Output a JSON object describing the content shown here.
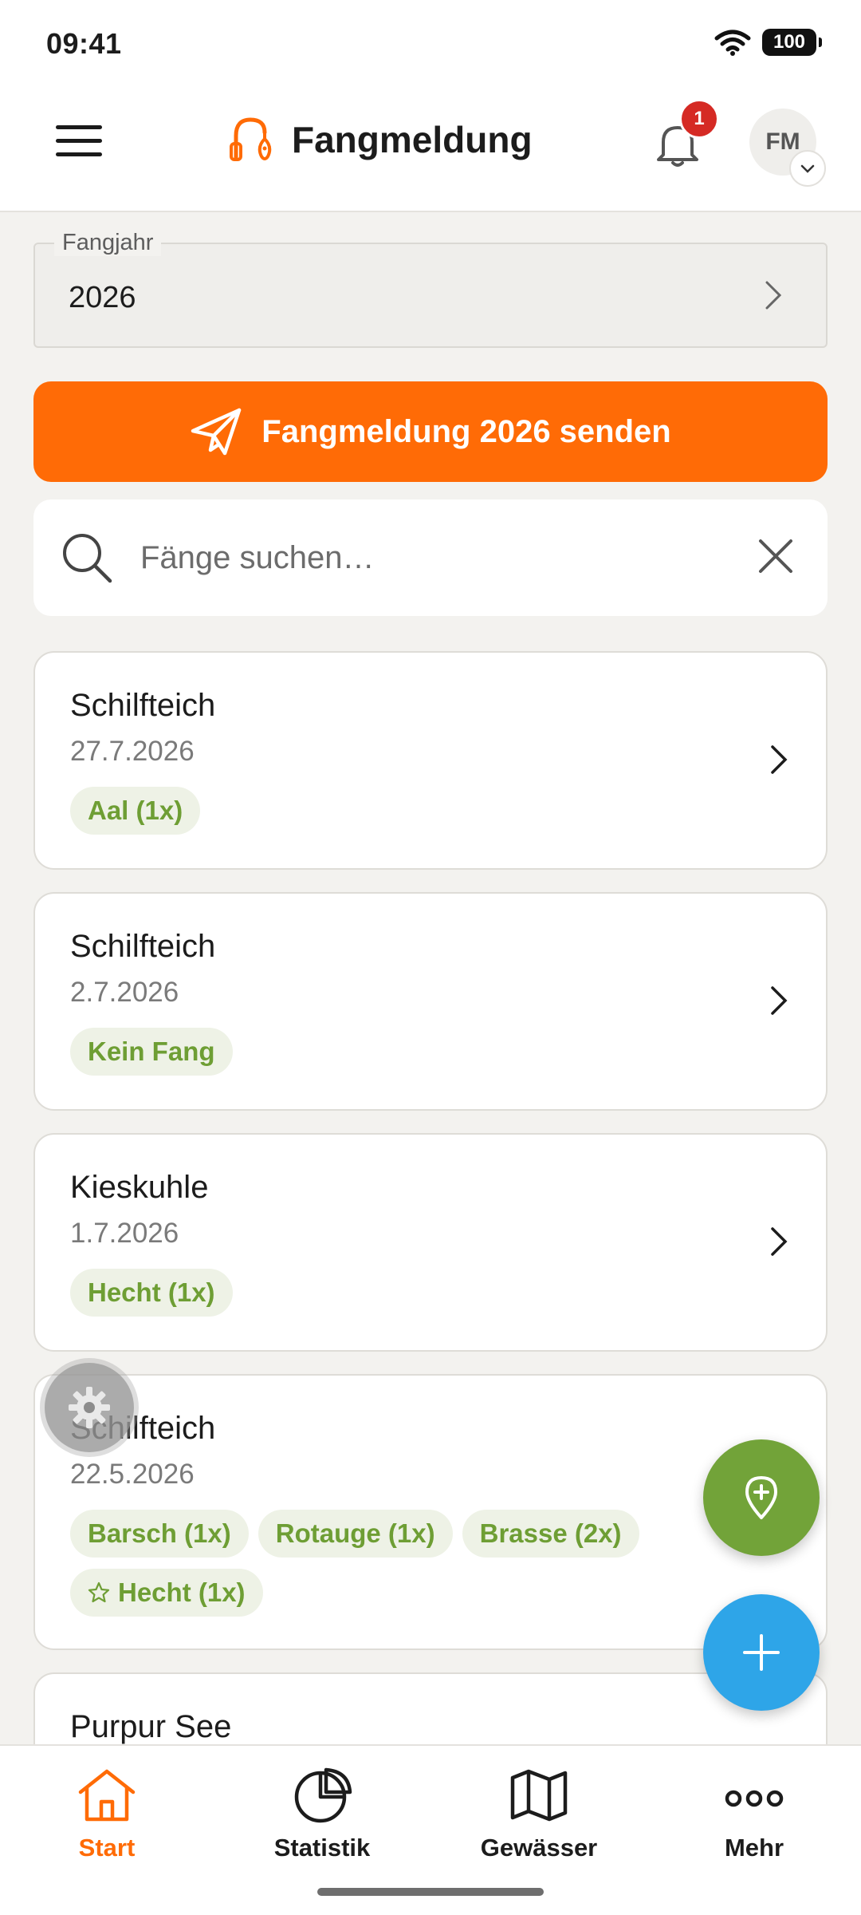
{
  "status_bar": {
    "time": "09:41",
    "battery": "100"
  },
  "header": {
    "title": "Fangmeldung",
    "notification_count": "1",
    "avatar_initials": "FM"
  },
  "year_field": {
    "label": "Fangjahr",
    "value": "2026"
  },
  "send_button": {
    "label": "Fangmeldung 2026 senden"
  },
  "search": {
    "placeholder": "Fänge suchen…",
    "value": ""
  },
  "catches": [
    {
      "water": "Schilfteich",
      "date": "27.7.2026",
      "tags": [
        "Aal (1x)"
      ]
    },
    {
      "water": "Schilfteich",
      "date": "2.7.2026",
      "tags": [
        "Kein Fang"
      ]
    },
    {
      "water": "Kieskuhle",
      "date": "1.7.2026",
      "tags": [
        "Hecht (1x)"
      ]
    },
    {
      "water": "Schilfteich",
      "date": "22.5.2026",
      "tags": [
        "Barsch (1x)",
        "Rotauge (1x)",
        "Brasse (2x)",
        "Hecht (1x)"
      ]
    },
    {
      "water": "Purpur See"
    }
  ],
  "bottom_nav": [
    {
      "label": "Start",
      "icon": "home-icon",
      "active": true
    },
    {
      "label": "Statistik",
      "icon": "pie-chart-icon"
    },
    {
      "label": "Gewässer",
      "icon": "map-icon"
    },
    {
      "label": "Mehr",
      "icon": "more-icon"
    }
  ],
  "colors": {
    "accent": "#ff6b06",
    "tag_green": "#6e9e34",
    "fab_green": "#72a339",
    "fab_blue": "#2ea5e8",
    "badge_red": "#d52a24"
  }
}
